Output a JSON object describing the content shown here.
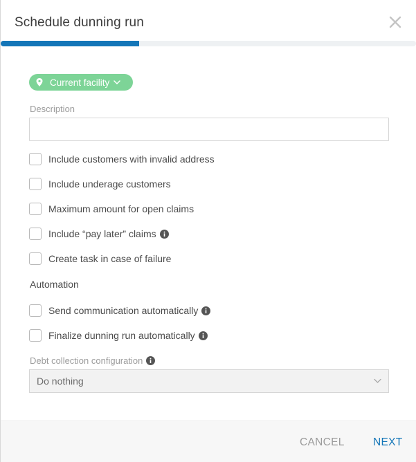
{
  "dialog": {
    "title": "Schedule dunning run",
    "progress_fraction": 0.333
  },
  "facility_selector": {
    "label": "Current facility"
  },
  "description": {
    "label": "Description",
    "value": ""
  },
  "options": [
    {
      "label": "Include customers with invalid address",
      "checked": false,
      "info": false
    },
    {
      "label": "Include underage customers",
      "checked": false,
      "info": false
    },
    {
      "label": "Maximum amount for open claims",
      "checked": false,
      "info": false
    },
    {
      "label": "Include “pay later” claims",
      "checked": false,
      "info": true
    },
    {
      "label": "Create task in case of failure",
      "checked": false,
      "info": false
    }
  ],
  "automation": {
    "section_label": "Automation",
    "options": [
      {
        "label": "Send communication automatically",
        "checked": false,
        "info": true
      },
      {
        "label": "Finalize dunning run automatically",
        "checked": false,
        "info": true
      }
    ]
  },
  "debt_collection": {
    "label": "Debt collection configuration",
    "selected": "Do nothing"
  },
  "footer": {
    "cancel_label": "CANCEL",
    "next_label": "NEXT"
  },
  "colors": {
    "accent": "#1476b8",
    "pill": "#7dd497",
    "progress_track": "#eef1f3"
  }
}
